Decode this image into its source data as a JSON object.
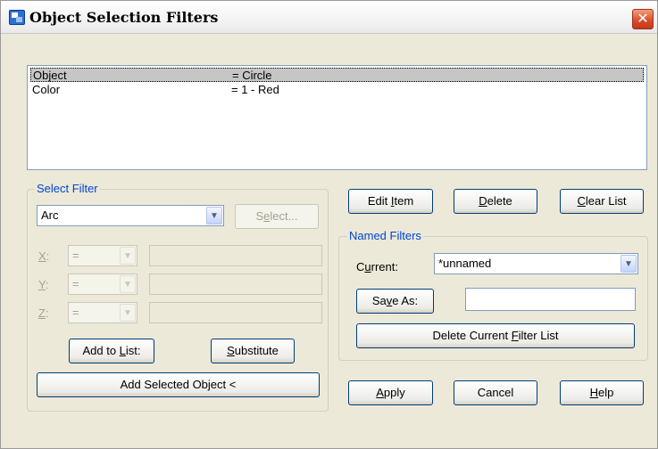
{
  "window": {
    "title": "Object Selection Filters",
    "close_glyph": "✕"
  },
  "filter_list": {
    "rows": [
      {
        "key": "Object",
        "value": "= Circle",
        "selected": true
      },
      {
        "key": "Color",
        "value": "= 1 - Red",
        "selected": false
      }
    ]
  },
  "select_filter": {
    "group_label": "Select Filter",
    "type_value": "Arc",
    "select_button": {
      "pre": "S",
      "ul": "e",
      "post": "lect..."
    },
    "coords": [
      {
        "label": "X",
        "suffix": ":",
        "op": "=",
        "value": ""
      },
      {
        "label": "Y",
        "suffix": ":",
        "op": "=",
        "value": ""
      },
      {
        "label": "Z",
        "suffix": ":",
        "op": "=",
        "value": ""
      }
    ],
    "add_to_list": {
      "pre": "Add to ",
      "ul": "L",
      "post": "ist:"
    },
    "substitute": {
      "pre": "",
      "ul": "S",
      "post": "ubstitute"
    },
    "add_selected": "Add Selected Object <"
  },
  "list_actions": {
    "edit_item": {
      "pre": "Edit ",
      "ul": "I",
      "post": "tem"
    },
    "delete": {
      "pre": "",
      "ul": "D",
      "post": "elete"
    },
    "clear_list": {
      "pre": "",
      "ul": "C",
      "post": "lear List"
    }
  },
  "named_filters": {
    "group_label": "Named Filters",
    "current_label": {
      "pre": "C",
      "ul": "u",
      "post": "rrent:"
    },
    "current_value": "*unnamed",
    "save_as": {
      "pre": "Sa",
      "ul": "v",
      "post": "e As:"
    },
    "save_as_value": "",
    "delete_current": {
      "pre": "Delete Current ",
      "ul": "F",
      "post": "ilter List"
    }
  },
  "footer": {
    "apply": {
      "pre": "",
      "ul": "A",
      "post": "pply"
    },
    "cancel": "Cancel",
    "help": {
      "pre": "",
      "ul": "H",
      "post": "elp"
    }
  },
  "colors": {
    "accent": "#0046d5",
    "dialog_bg": "#ece9d8",
    "border": "#003c74"
  },
  "icons": {
    "app": "dialog-app-icon",
    "dropdown": "chevron-down-icon",
    "close": "close-icon"
  }
}
